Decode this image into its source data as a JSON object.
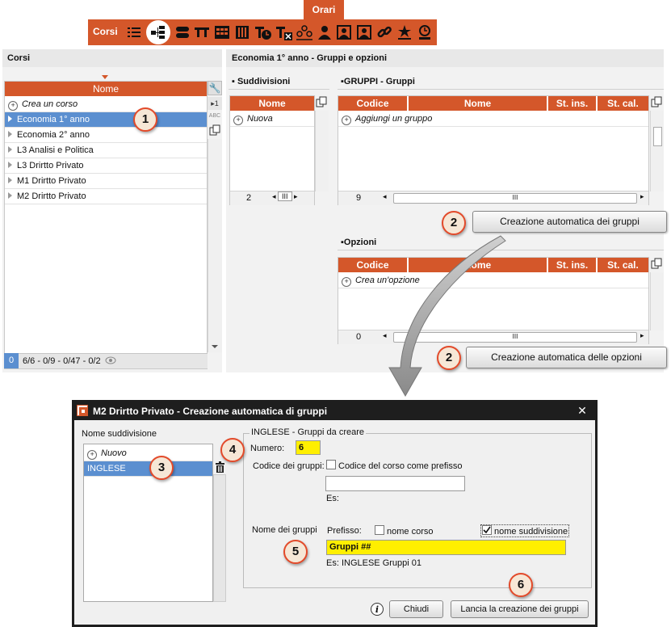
{
  "toolbar": {
    "tab_label": "Orari",
    "corsi_label": "Corsi",
    "icons": [
      "list-icon",
      "tree-active-icon",
      "pill-icon",
      "tt-icon",
      "grid-icon",
      "columns-icon",
      "t-clock-icon",
      "t-x-icon",
      "group-icon",
      "person-icon",
      "portrait-icon",
      "portrait2-icon",
      "link-icon",
      "star-person-icon",
      "clock-person-icon"
    ]
  },
  "left_panel": {
    "title": "Corsi",
    "column_header": "Nome",
    "add_label": "Crea un corso",
    "rows": [
      "Economia 1° anno",
      "Economia 2° anno",
      "L3 Analisi e Politica",
      "L3 Drirtto Privato",
      "M1 Drirtto Privato",
      "M2 Drirtto Privato"
    ],
    "status_count": "0",
    "status_text": "6/6 - 0/9 - 0/47 - 0/2",
    "side_btn_1": "▸1",
    "side_btn_abc": "ABC"
  },
  "right_panel": {
    "title": "Economia 1° anno - Gruppi e opzioni",
    "suddivisioni": {
      "title": "Suddivisioni",
      "column": "Nome",
      "add_label": "Nuova",
      "count": "2"
    },
    "gruppi": {
      "title": "GRUPPI - Gruppi",
      "columns": [
        "Codice",
        "Nome",
        "St. ins.",
        "St. cal."
      ],
      "add_label": "Aggiungi un gruppo",
      "count": "9",
      "auto_button": "Creazione automatica dei gruppi"
    },
    "opzioni": {
      "title": "Opzioni",
      "columns": [
        "Codice",
        "Nome",
        "St. ins.",
        "St. cal."
      ],
      "add_label": "Crea un'opzione",
      "count": "0",
      "auto_button": "Creazione automatica delle opzioni"
    }
  },
  "dialog": {
    "title": "M2 Drirtto Privato - Creazione automatica di gruppi",
    "close": "✕",
    "list_title": "Nome suddivisione",
    "list_add": "Nuovo",
    "list_selected": "INGLESE",
    "group_title": "INGLESE - Gruppi da creare",
    "numero_label": "Numero:",
    "numero_value": "6",
    "codice_label": "Codice dei gruppi:",
    "codice_checkbox": "Codice del corso come prefisso",
    "codice_es": "Es:",
    "nome_label": "Nome dei gruppi",
    "prefisso_label": "Prefisso:",
    "prefisso_corso": "nome corso",
    "prefisso_suddivisione": "nome suddivisione",
    "nome_value": "Gruppi  ##",
    "nome_es": "Es: INGLESE Gruppi  01",
    "chiudi": "Chiudi",
    "lancia": "Lancia la creazione dei gruppi",
    "info": "i"
  },
  "badges": [
    "1",
    "2",
    "2",
    "3",
    "4",
    "5",
    "6"
  ],
  "colors": {
    "accent": "#d4572a",
    "selected": "#5b8fd0",
    "highlight": "#ffef00",
    "badge_ring": "#e34a2a"
  }
}
